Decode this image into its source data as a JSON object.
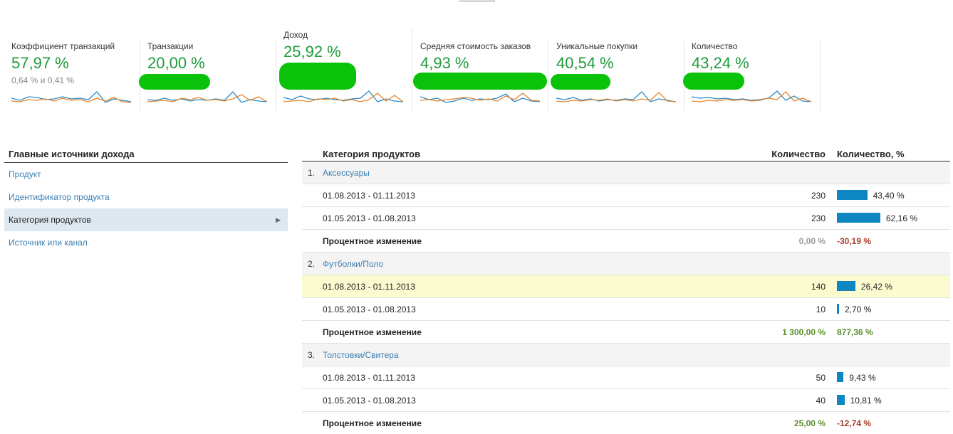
{
  "metrics": [
    {
      "label": "Коэффициент транзакций",
      "value": "57,97 %",
      "sub": "0,64 % и 0,41 %"
    },
    {
      "label": "Транзакции",
      "value": "20,00 %"
    },
    {
      "label": "Доход",
      "value": "25,92 %"
    },
    {
      "label": "Средняя стоимость заказов",
      "value": "4,93 %"
    },
    {
      "label": "Уникальные покупки",
      "value": "40,54 %"
    },
    {
      "label": "Количество",
      "value": "43,24 %"
    }
  ],
  "colors": {
    "accent": "#1e9b3a",
    "link": "#3a7fb0",
    "bar": "#0e86c2",
    "series_current": "#2a8ac4",
    "series_previous": "#e8852a",
    "positive": "#5b8f2a",
    "negative": "#a63a2a",
    "neutral": "#999999"
  },
  "left_nav": {
    "header": "Главные источники дохода",
    "items": [
      {
        "label": "Продукт"
      },
      {
        "label": "Идентификатор продукта"
      },
      {
        "label": "Категория продуктов",
        "active": true
      },
      {
        "label": "Источник или канал"
      }
    ]
  },
  "table": {
    "headers": {
      "category": "Категория продуктов",
      "qty": "Количество",
      "qty_pct": "Количество, %"
    },
    "groups": [
      {
        "num": "1.",
        "name": "Аксессуары",
        "rows": [
          {
            "date": "01.08.2013 - 01.11.2013",
            "qty": "230",
            "pct": "43,40 %",
            "pct_value": 43.4
          },
          {
            "date": "01.05.2013 - 01.08.2013",
            "qty": "230",
            "pct": "62,16 %",
            "pct_value": 62.16
          }
        ],
        "change": {
          "label": "Процентное изменение",
          "qty": "0,00 %",
          "pct": "-30,19 %"
        }
      },
      {
        "num": "2.",
        "name": "Футболки/Поло",
        "rows": [
          {
            "date": "01.08.2013 - 01.11.2013",
            "qty": "140",
            "pct": "26,42 %",
            "pct_value": 26.42
          },
          {
            "date": "01.05.2013 - 01.08.2013",
            "qty": "10",
            "pct": "2,70 %",
            "pct_value": 2.7
          }
        ],
        "change": {
          "label": "Процентное изменение",
          "qty": "1 300,00 %",
          "pct": "877,36 %"
        }
      },
      {
        "num": "3.",
        "name": "Толстовки/Свитера",
        "rows": [
          {
            "date": "01.08.2013 - 01.11.2013",
            "qty": "50",
            "pct": "9,43 %",
            "pct_value": 9.43
          },
          {
            "date": "01.05.2013 - 01.08.2013",
            "qty": "40",
            "pct": "10,81 %",
            "pct_value": 10.81
          }
        ],
        "change": {
          "label": "Процентное изменение",
          "qty": "25,00 %",
          "pct": "-12,74 %"
        }
      }
    ]
  }
}
